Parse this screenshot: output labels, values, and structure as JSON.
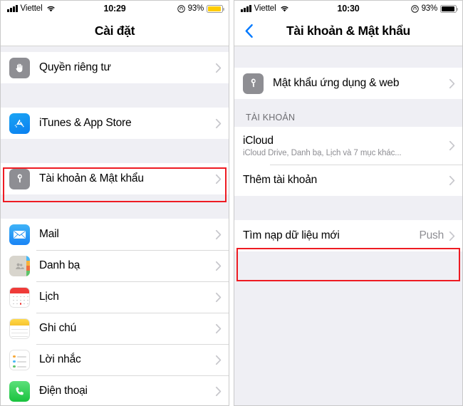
{
  "left": {
    "status": {
      "carrier": "Viettel",
      "time": "10:29",
      "battery_percent": "93%",
      "battery_color": "#ffcc00",
      "battery_level": 93
    },
    "nav": {
      "title": "Cài đặt"
    },
    "groups": [
      {
        "rows": [
          {
            "label": "Quyền riêng tư",
            "icon": "hand-icon",
            "icon_style": "gray"
          }
        ]
      },
      {
        "rows": [
          {
            "label": "iTunes & App Store",
            "icon": "app-store-icon",
            "icon_style": "appstore"
          }
        ]
      },
      {
        "highlighted": true,
        "rows": [
          {
            "label": "Tài khoản & Mật khẩu",
            "icon": "key-icon",
            "icon_style": "gray"
          }
        ]
      },
      {
        "rows": [
          {
            "label": "Mail",
            "icon": "mail-icon",
            "icon_style": "mail"
          },
          {
            "label": "Danh bạ",
            "icon": "contacts-icon",
            "icon_style": "contacts"
          },
          {
            "label": "Lịch",
            "icon": "calendar-icon",
            "icon_style": "calendar"
          },
          {
            "label": "Ghi chú",
            "icon": "notes-icon",
            "icon_style": "notes"
          },
          {
            "label": "Lời nhắc",
            "icon": "reminders-icon",
            "icon_style": "reminders"
          },
          {
            "label": "Điện thoại",
            "icon": "phone-icon",
            "icon_style": "phone"
          }
        ]
      }
    ]
  },
  "right": {
    "status": {
      "carrier": "Viettel",
      "time": "10:30",
      "battery_percent": "93%",
      "battery_color": "#000000",
      "battery_level": 93
    },
    "nav": {
      "title": "Tài khoản & Mật khẩu",
      "back": "back-chevron"
    },
    "password_row": {
      "label": "Mật khẩu ứng dụng & web",
      "icon": "key-icon"
    },
    "accounts_header": "TÀI KHOẢN",
    "accounts": [
      {
        "label": "iCloud",
        "sub": "iCloud Drive, Danh bạ, Lịch và 7 mục khác..."
      },
      {
        "label": "Thêm tài khoản",
        "sub": ""
      }
    ],
    "fetch_row": {
      "label": "Tìm nạp dữ liệu mới",
      "value": "Push",
      "highlighted": true
    }
  },
  "accent": {
    "highlight": "#ee1b22",
    "tint": "#007aff",
    "secondary_text": "#8e8e93"
  }
}
